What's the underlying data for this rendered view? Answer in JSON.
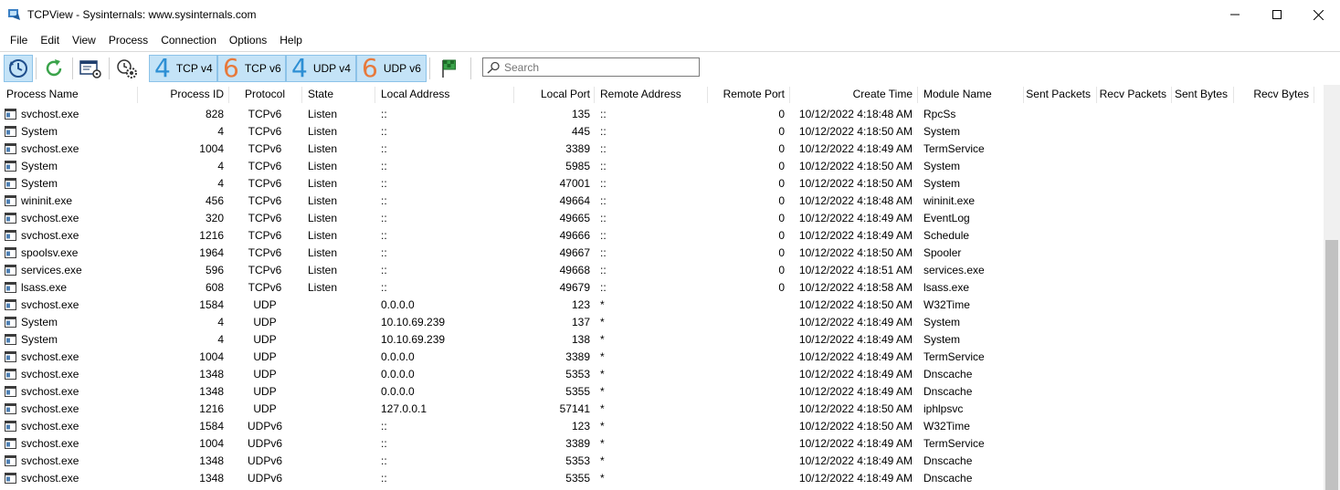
{
  "window": {
    "title": "TCPView - Sysinternals: www.sysinternals.com",
    "controls": {
      "minimize": "—",
      "maximize": "☐",
      "close": "✕"
    }
  },
  "menu": [
    "File",
    "Edit",
    "View",
    "Process",
    "Connection",
    "Options",
    "Help"
  ],
  "toolbar": {
    "protocols": [
      {
        "digit": "4",
        "label": "TCP v4",
        "color": "#2d8fd4"
      },
      {
        "digit": "6",
        "label": "TCP v6",
        "color": "#e7793b"
      },
      {
        "digit": "4",
        "label": "UDP v4",
        "color": "#2d8fd4"
      },
      {
        "digit": "6",
        "label": "UDP v6",
        "color": "#e7793b"
      }
    ],
    "search_placeholder": "Search"
  },
  "columns": [
    "Process Name",
    "Process ID",
    "Protocol",
    "State",
    "Local Address",
    "Local Port",
    "Remote Address",
    "Remote Port",
    "Create Time",
    "Module Name",
    "Sent Packets",
    "Recv Packets",
    "Sent Bytes",
    "Recv Bytes"
  ],
  "rows": [
    [
      "svchost.exe",
      "828",
      "TCPv6",
      "Listen",
      "::",
      "135",
      "::",
      "0",
      "10/12/2022 4:18:48 AM",
      "RpcSs"
    ],
    [
      "System",
      "4",
      "TCPv6",
      "Listen",
      "::",
      "445",
      "::",
      "0",
      "10/12/2022 4:18:50 AM",
      "System"
    ],
    [
      "svchost.exe",
      "1004",
      "TCPv6",
      "Listen",
      "::",
      "3389",
      "::",
      "0",
      "10/12/2022 4:18:49 AM",
      "TermService"
    ],
    [
      "System",
      "4",
      "TCPv6",
      "Listen",
      "::",
      "5985",
      "::",
      "0",
      "10/12/2022 4:18:50 AM",
      "System"
    ],
    [
      "System",
      "4",
      "TCPv6",
      "Listen",
      "::",
      "47001",
      "::",
      "0",
      "10/12/2022 4:18:50 AM",
      "System"
    ],
    [
      "wininit.exe",
      "456",
      "TCPv6",
      "Listen",
      "::",
      "49664",
      "::",
      "0",
      "10/12/2022 4:18:48 AM",
      "wininit.exe"
    ],
    [
      "svchost.exe",
      "320",
      "TCPv6",
      "Listen",
      "::",
      "49665",
      "::",
      "0",
      "10/12/2022 4:18:49 AM",
      "EventLog"
    ],
    [
      "svchost.exe",
      "1216",
      "TCPv6",
      "Listen",
      "::",
      "49666",
      "::",
      "0",
      "10/12/2022 4:18:49 AM",
      "Schedule"
    ],
    [
      "spoolsv.exe",
      "1964",
      "TCPv6",
      "Listen",
      "::",
      "49667",
      "::",
      "0",
      "10/12/2022 4:18:50 AM",
      "Spooler"
    ],
    [
      "services.exe",
      "596",
      "TCPv6",
      "Listen",
      "::",
      "49668",
      "::",
      "0",
      "10/12/2022 4:18:51 AM",
      "services.exe"
    ],
    [
      "lsass.exe",
      "608",
      "TCPv6",
      "Listen",
      "::",
      "49679",
      "::",
      "0",
      "10/12/2022 4:18:58 AM",
      "lsass.exe"
    ],
    [
      "svchost.exe",
      "1584",
      "UDP",
      "",
      "0.0.0.0",
      "123",
      "*",
      "",
      "10/12/2022 4:18:50 AM",
      "W32Time"
    ],
    [
      "System",
      "4",
      "UDP",
      "",
      "10.10.69.239",
      "137",
      "*",
      "",
      "10/12/2022 4:18:49 AM",
      "System"
    ],
    [
      "System",
      "4",
      "UDP",
      "",
      "10.10.69.239",
      "138",
      "*",
      "",
      "10/12/2022 4:18:49 AM",
      "System"
    ],
    [
      "svchost.exe",
      "1004",
      "UDP",
      "",
      "0.0.0.0",
      "3389",
      "*",
      "",
      "10/12/2022 4:18:49 AM",
      "TermService"
    ],
    [
      "svchost.exe",
      "1348",
      "UDP",
      "",
      "0.0.0.0",
      "5353",
      "*",
      "",
      "10/12/2022 4:18:49 AM",
      "Dnscache"
    ],
    [
      "svchost.exe",
      "1348",
      "UDP",
      "",
      "0.0.0.0",
      "5355",
      "*",
      "",
      "10/12/2022 4:18:49 AM",
      "Dnscache"
    ],
    [
      "svchost.exe",
      "1216",
      "UDP",
      "",
      "127.0.0.1",
      "57141",
      "*",
      "",
      "10/12/2022 4:18:50 AM",
      "iphlpsvc"
    ],
    [
      "svchost.exe",
      "1584",
      "UDPv6",
      "",
      "::",
      "123",
      "*",
      "",
      "10/12/2022 4:18:50 AM",
      "W32Time"
    ],
    [
      "svchost.exe",
      "1004",
      "UDPv6",
      "",
      "::",
      "3389",
      "*",
      "",
      "10/12/2022 4:18:49 AM",
      "TermService"
    ],
    [
      "svchost.exe",
      "1348",
      "UDPv6",
      "",
      "::",
      "5353",
      "*",
      "",
      "10/12/2022 4:18:49 AM",
      "Dnscache"
    ],
    [
      "svchost.exe",
      "1348",
      "UDPv6",
      "",
      "::",
      "5355",
      "*",
      "",
      "10/12/2022 4:18:49 AM",
      "Dnscache"
    ]
  ]
}
